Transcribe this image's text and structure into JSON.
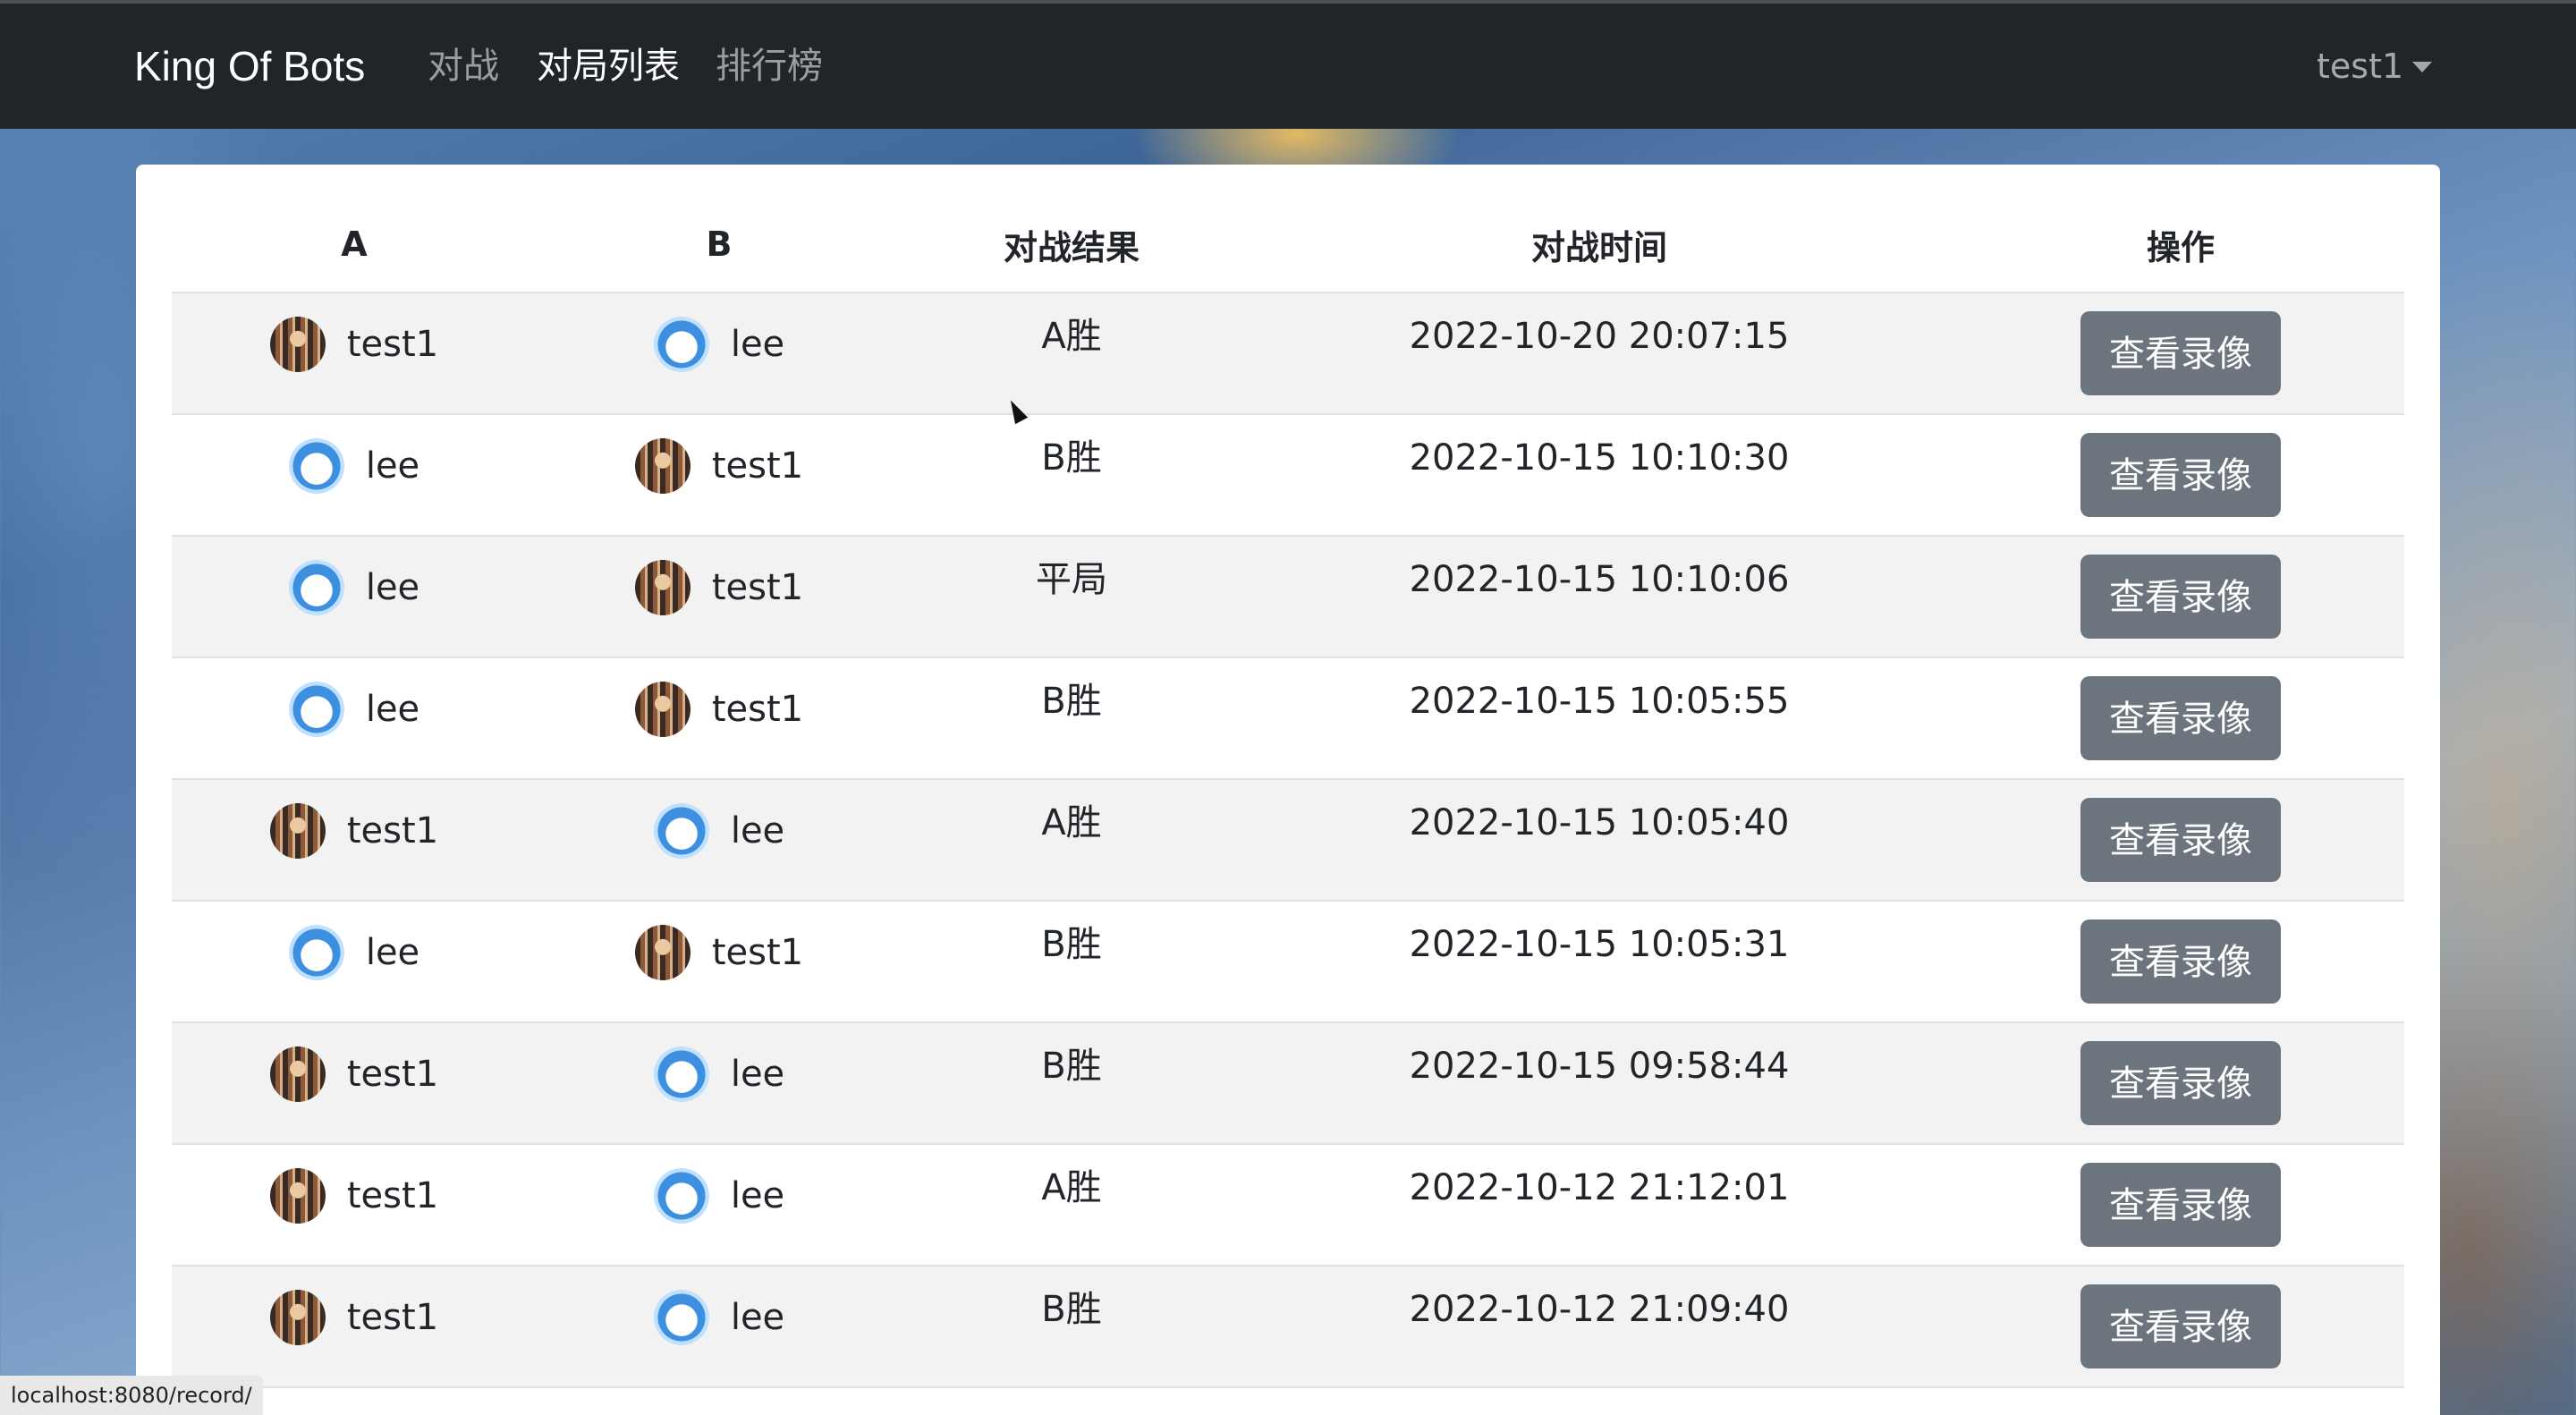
{
  "navbar": {
    "brand": "King Of Bots",
    "links": [
      {
        "label": "对战",
        "active": false
      },
      {
        "label": "对局列表",
        "active": true
      },
      {
        "label": "排行榜",
        "active": false
      }
    ],
    "user": "test1"
  },
  "table": {
    "headers": [
      "A",
      "B",
      "对战结果",
      "对战时间",
      "操作"
    ],
    "rows": [
      {
        "a": {
          "name": "test1",
          "avatar": "anime-avatar"
        },
        "b": {
          "name": "lee",
          "avatar": "penguin-avatar"
        },
        "result": "A胜",
        "time": "2022-10-20 20:07:15",
        "action": "查看录像"
      },
      {
        "a": {
          "name": "lee",
          "avatar": "penguin-avatar"
        },
        "b": {
          "name": "test1",
          "avatar": "anime-avatar"
        },
        "result": "B胜",
        "time": "2022-10-15 10:10:30",
        "action": "查看录像"
      },
      {
        "a": {
          "name": "lee",
          "avatar": "penguin-avatar"
        },
        "b": {
          "name": "test1",
          "avatar": "anime-avatar"
        },
        "result": "平局",
        "time": "2022-10-15 10:10:06",
        "action": "查看录像"
      },
      {
        "a": {
          "name": "lee",
          "avatar": "penguin-avatar"
        },
        "b": {
          "name": "test1",
          "avatar": "anime-avatar"
        },
        "result": "B胜",
        "time": "2022-10-15 10:05:55",
        "action": "查看录像"
      },
      {
        "a": {
          "name": "test1",
          "avatar": "anime-avatar"
        },
        "b": {
          "name": "lee",
          "avatar": "penguin-avatar"
        },
        "result": "A胜",
        "time": "2022-10-15 10:05:40",
        "action": "查看录像"
      },
      {
        "a": {
          "name": "lee",
          "avatar": "penguin-avatar"
        },
        "b": {
          "name": "test1",
          "avatar": "anime-avatar"
        },
        "result": "B胜",
        "time": "2022-10-15 10:05:31",
        "action": "查看录像"
      },
      {
        "a": {
          "name": "test1",
          "avatar": "anime-avatar"
        },
        "b": {
          "name": "lee",
          "avatar": "penguin-avatar"
        },
        "result": "B胜",
        "time": "2022-10-15 09:58:44",
        "action": "查看录像"
      },
      {
        "a": {
          "name": "test1",
          "avatar": "anime-avatar"
        },
        "b": {
          "name": "lee",
          "avatar": "penguin-avatar"
        },
        "result": "A胜",
        "time": "2022-10-12 21:12:01",
        "action": "查看录像"
      },
      {
        "a": {
          "name": "test1",
          "avatar": "anime-avatar"
        },
        "b": {
          "name": "lee",
          "avatar": "penguin-avatar"
        },
        "result": "B胜",
        "time": "2022-10-12 21:09:40",
        "action": "查看录像"
      }
    ]
  },
  "statusbar": {
    "url": "localhost:8080/record/"
  },
  "colors": {
    "navbar_bg": "#212529",
    "button_bg": "#6c757d",
    "stripe_bg": "#f2f2f2"
  }
}
